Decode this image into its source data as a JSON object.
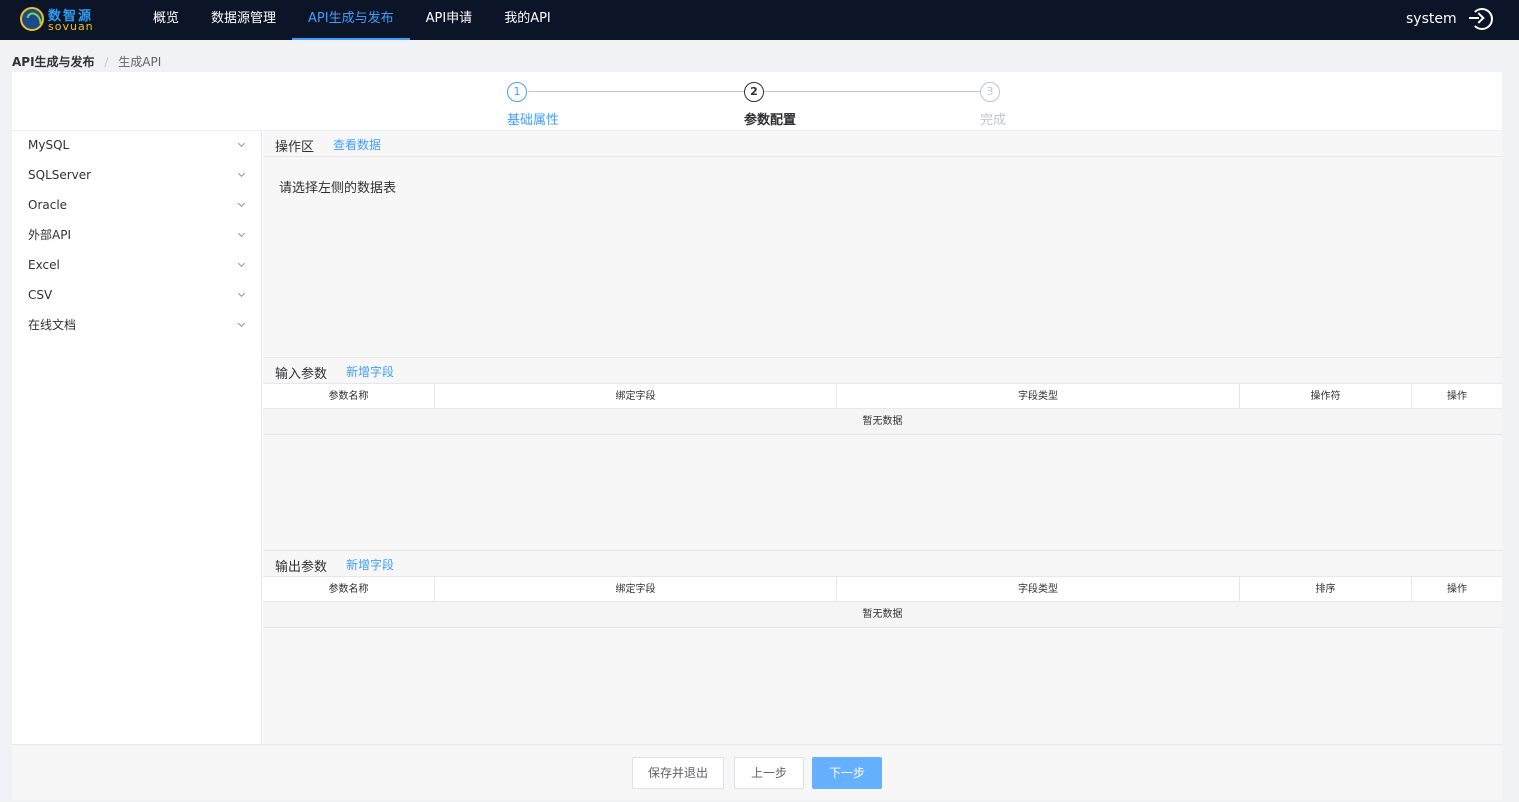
{
  "brand": {
    "name_cn": "数智源",
    "name_en": "sovuan"
  },
  "nav": {
    "items": [
      {
        "label": "概览"
      },
      {
        "label": "数据源管理"
      },
      {
        "label": "API生成与发布"
      },
      {
        "label": "API申请"
      },
      {
        "label": "我的API"
      }
    ],
    "active_index": 2,
    "user": "system"
  },
  "breadcrumb": {
    "main": "API生成与发布",
    "separator": "/",
    "sub": "生成API"
  },
  "steps": [
    {
      "num": "1",
      "label": "基础属性",
      "state": "done"
    },
    {
      "num": "2",
      "label": "参数配置",
      "state": "current"
    },
    {
      "num": "3",
      "label": "完成",
      "state": "wait"
    }
  ],
  "sidebar": {
    "items": [
      {
        "label": "MySQL"
      },
      {
        "label": "SQLServer"
      },
      {
        "label": "Oracle"
      },
      {
        "label": "外部API"
      },
      {
        "label": "Excel"
      },
      {
        "label": "CSV"
      },
      {
        "label": "在线文档"
      }
    ]
  },
  "operation": {
    "title": "操作区",
    "link": "查看数据",
    "hint": "请选择左侧的数据表"
  },
  "input_params": {
    "title": "输入参数",
    "link": "新增字段",
    "columns": [
      "参数名称",
      "绑定字段",
      "字段类型",
      "操作符",
      "操作"
    ],
    "empty": "暂无数据"
  },
  "output_params": {
    "title": "输出参数",
    "link": "新增字段",
    "columns": [
      "参数名称",
      "绑定字段",
      "字段类型",
      "排序",
      "操作"
    ],
    "empty": "暂无数据"
  },
  "buttons": {
    "save_exit": "保存并退出",
    "prev": "上一步",
    "next": "下一步"
  },
  "colors": {
    "accent": "#409eff",
    "topbar": "#0c1527",
    "primary_button": "#66b1ff"
  }
}
